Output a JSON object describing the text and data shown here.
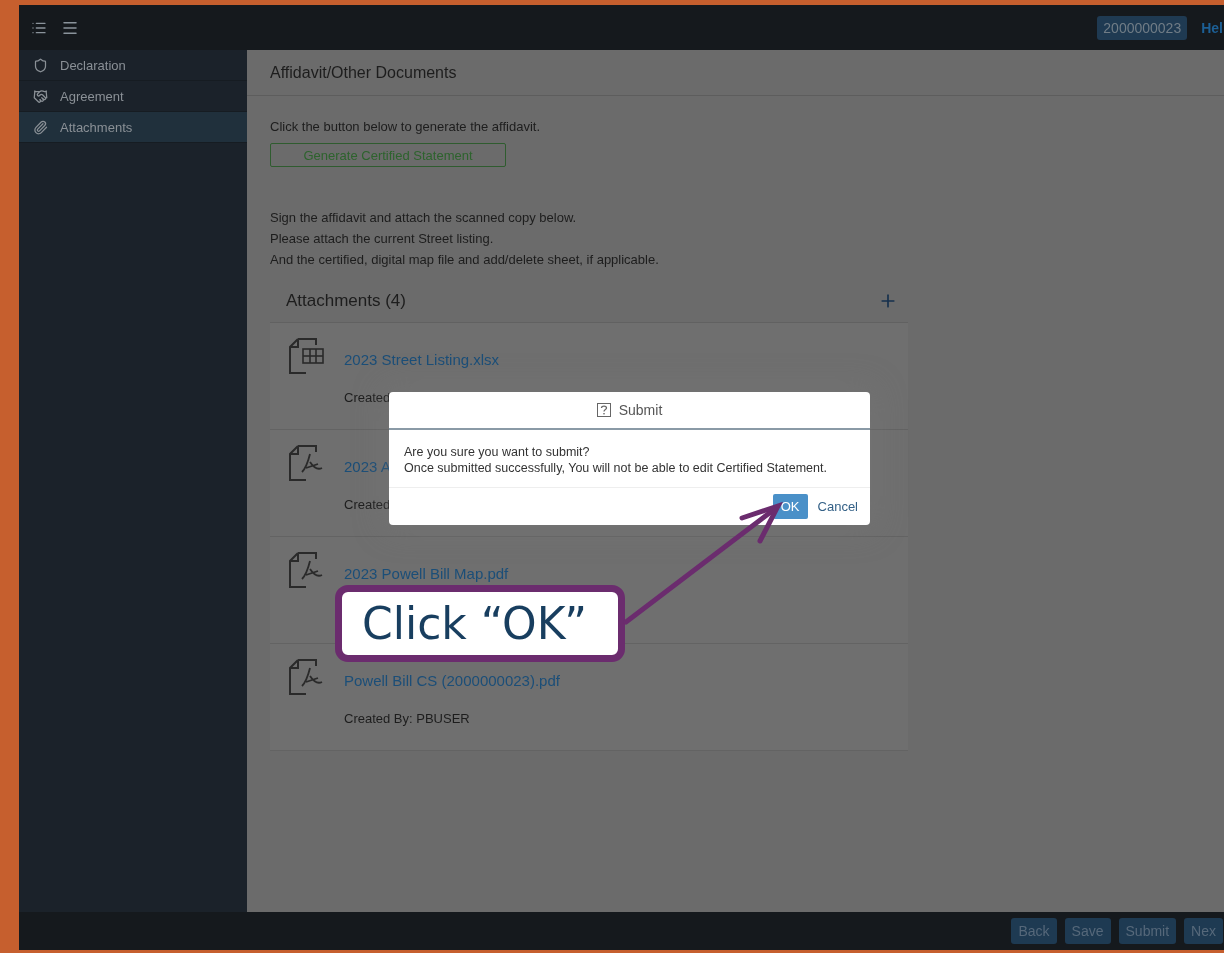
{
  "header": {
    "account_id": "2000000023",
    "help_link": "Hel"
  },
  "sidebar": {
    "items": [
      {
        "label": "Declaration",
        "selected": false
      },
      {
        "label": "Agreement",
        "selected": false
      },
      {
        "label": "Attachments",
        "selected": true
      }
    ]
  },
  "main": {
    "title": "Affidavit/Other Documents",
    "intro": "Click the button below to generate the affidavit.",
    "generate_button": "Generate Certified Statement",
    "notes": [
      "Sign the affidavit and attach the scanned copy below.",
      "Please attach the current Street listing.",
      "And the certified, digital map file and add/delete sheet, if applicable."
    ],
    "attachments": {
      "title": "Attachments (4)",
      "items": [
        {
          "kind": "spreadsheet",
          "name": "2023 Street Listing.xlsx",
          "created": "Created"
        },
        {
          "kind": "pdf",
          "name": "2023 A",
          "created": "Created"
        },
        {
          "kind": "pdf",
          "name": "2023 Powell Bill Map.pdf"
        },
        {
          "kind": "pdf",
          "name": "Powell Bill CS (2000000023).pdf",
          "created": "Created By: PBUSER"
        }
      ]
    }
  },
  "dialog": {
    "title": "Submit",
    "message": [
      "Are you sure you want to submit?",
      "Once submitted successfully, You will not be able to edit Certified Statement."
    ],
    "ok": "OK",
    "cancel": "Cancel"
  },
  "callout": {
    "text": "Click “OK”"
  },
  "footer": {
    "buttons": [
      "Back",
      "Save",
      "Submit",
      "Nex"
    ]
  }
}
